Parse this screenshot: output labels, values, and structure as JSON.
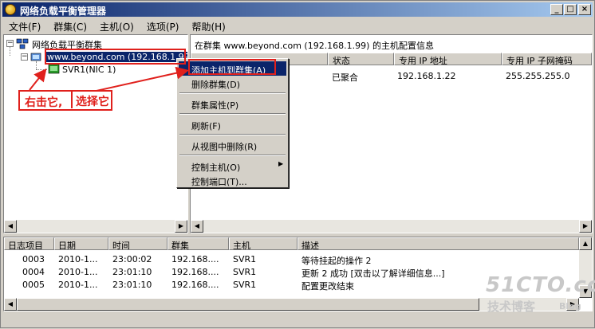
{
  "window": {
    "title": "网络负载平衡管理器",
    "buttons": {
      "minimize": "_",
      "maximize": "□",
      "close": "×"
    }
  },
  "menubar": [
    "文件(F)",
    "群集(C)",
    "主机(O)",
    "选项(P)",
    "帮助(H)"
  ],
  "tree": {
    "root": "网络负载平衡群集",
    "cluster": "www.beyond.com (192.168.1.99)",
    "host": "SVR1(NIC 1)"
  },
  "detail": {
    "caption": "在群集 www.beyond.com (192.168.1.99) 的主机配置信息",
    "columns": [
      "",
      "状态",
      "专用 IP 地址",
      "专用 IP 子网掩码"
    ],
    "rows": [
      {
        "name": "",
        "status": "已聚合",
        "ip": "192.168.1.22",
        "mask": "255.255.255.0"
      }
    ]
  },
  "context_menu": {
    "items": [
      "添加主机到群集(A)",
      "删除群集(D)",
      "群集属性(P)",
      "刷新(F)",
      "从视图中删除(R)",
      "控制主机(O)",
      "控制端口(T)..."
    ]
  },
  "annotation": {
    "callout_left": "右击它,",
    "callout_right": "选择它"
  },
  "log": {
    "columns": [
      "日志项目",
      "日期",
      "时间",
      "群集",
      "主机",
      "描述"
    ],
    "rows": [
      {
        "id": "0003",
        "date": "2010-1...",
        "time": "23:00:02",
        "cluster": "192.168....",
        "host": "SVR1",
        "desc": "等待挂起的操作 2"
      },
      {
        "id": "0004",
        "date": "2010-1...",
        "time": "23:01:10",
        "cluster": "192.168....",
        "host": "SVR1",
        "desc": "更新 2 成功 [双击以了解详细信息...]"
      },
      {
        "id": "0005",
        "date": "2010-1...",
        "time": "23:01:10",
        "cluster": "192.168....",
        "host": "SVR1",
        "desc": "配置更改结束"
      }
    ]
  },
  "watermark": {
    "line1": "51CTO.com",
    "line2": "技术博客",
    "line3": "Blog"
  },
  "colors": {
    "titlebar": "#0a246a",
    "annotation_red": "#e0201c",
    "selection": "#0a246a"
  }
}
